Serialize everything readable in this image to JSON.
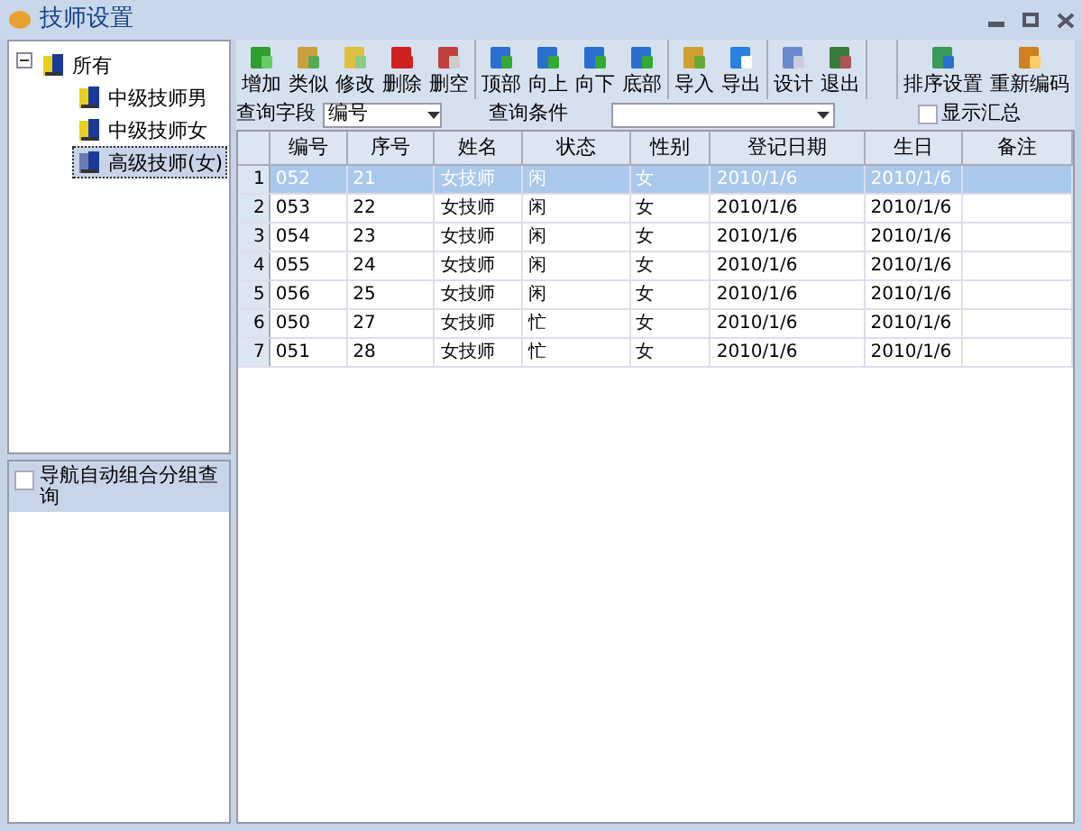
{
  "window": {
    "title": "技师设置"
  },
  "tree": [
    {
      "label": "所有",
      "expanded": true,
      "selected": false,
      "children": [
        {
          "label": "中级技师男",
          "selected": false
        },
        {
          "label": "中级技师女",
          "selected": false
        },
        {
          "label": "高级技师(女)",
          "selected": true
        }
      ]
    }
  ],
  "nav_panel": {
    "title": "导航自动组合分组查询",
    "checked": false
  },
  "toolbar": [
    [
      {
        "label": "增加"
      },
      {
        "label": "类似"
      },
      {
        "label": "修改"
      },
      {
        "label": "删除"
      },
      {
        "label": "删空"
      }
    ],
    [
      {
        "label": "顶部"
      },
      {
        "label": "向上"
      },
      {
        "label": "向下"
      },
      {
        "label": "底部"
      }
    ],
    [
      {
        "label": "导入"
      },
      {
        "label": "导出"
      }
    ],
    [
      {
        "label": "设计"
      },
      {
        "label": "退出"
      }
    ],
    [
      {
        "label": "排序设置"
      },
      {
        "label": "重新编码"
      }
    ]
  ],
  "query": {
    "field_label": "查询字段",
    "field_value": "编号",
    "condition_label": "查询条件",
    "show_summary": {
      "label": "显示汇总",
      "checked": false
    }
  },
  "table": {
    "columns": [
      "编号",
      "序号",
      "姓名",
      "状态",
      "性别",
      "登记日期",
      "生日",
      "备注"
    ],
    "rows": [
      {
        "index": "1",
        "cells": [
          "052",
          "21",
          "女技师",
          "闲",
          "女",
          "2010/1/6",
          "2010/1/6"
        ],
        "selected": true
      },
      {
        "index": "2",
        "cells": [
          "053",
          "22",
          "女技师",
          "闲",
          "女",
          "2010/1/6",
          "2010/1/6"
        ],
        "selected": false
      },
      {
        "index": "3",
        "cells": [
          "054",
          "23",
          "女技师",
          "闲",
          "女",
          "2010/1/6",
          "2010/1/6"
        ],
        "selected": false
      },
      {
        "index": "4",
        "cells": [
          "055",
          "24",
          "女技师",
          "闲",
          "女",
          "2010/1/6",
          "2010/1/6"
        ],
        "selected": false
      },
      {
        "index": "5",
        "cells": [
          "056",
          "25",
          "女技师",
          "闲",
          "女",
          "2010/1/6",
          "2010/1/6"
        ],
        "selected": false
      },
      {
        "index": "6",
        "cells": [
          "050",
          "27",
          "女技师",
          "忙",
          "女",
          "2010/1/6",
          "2010/1/6"
        ],
        "selected": false
      },
      {
        "index": "7",
        "cells": [
          "051",
          "28",
          "女技师",
          "忙",
          "女",
          "2010/1/6",
          "2010/1/6"
        ],
        "selected": false
      }
    ]
  }
}
